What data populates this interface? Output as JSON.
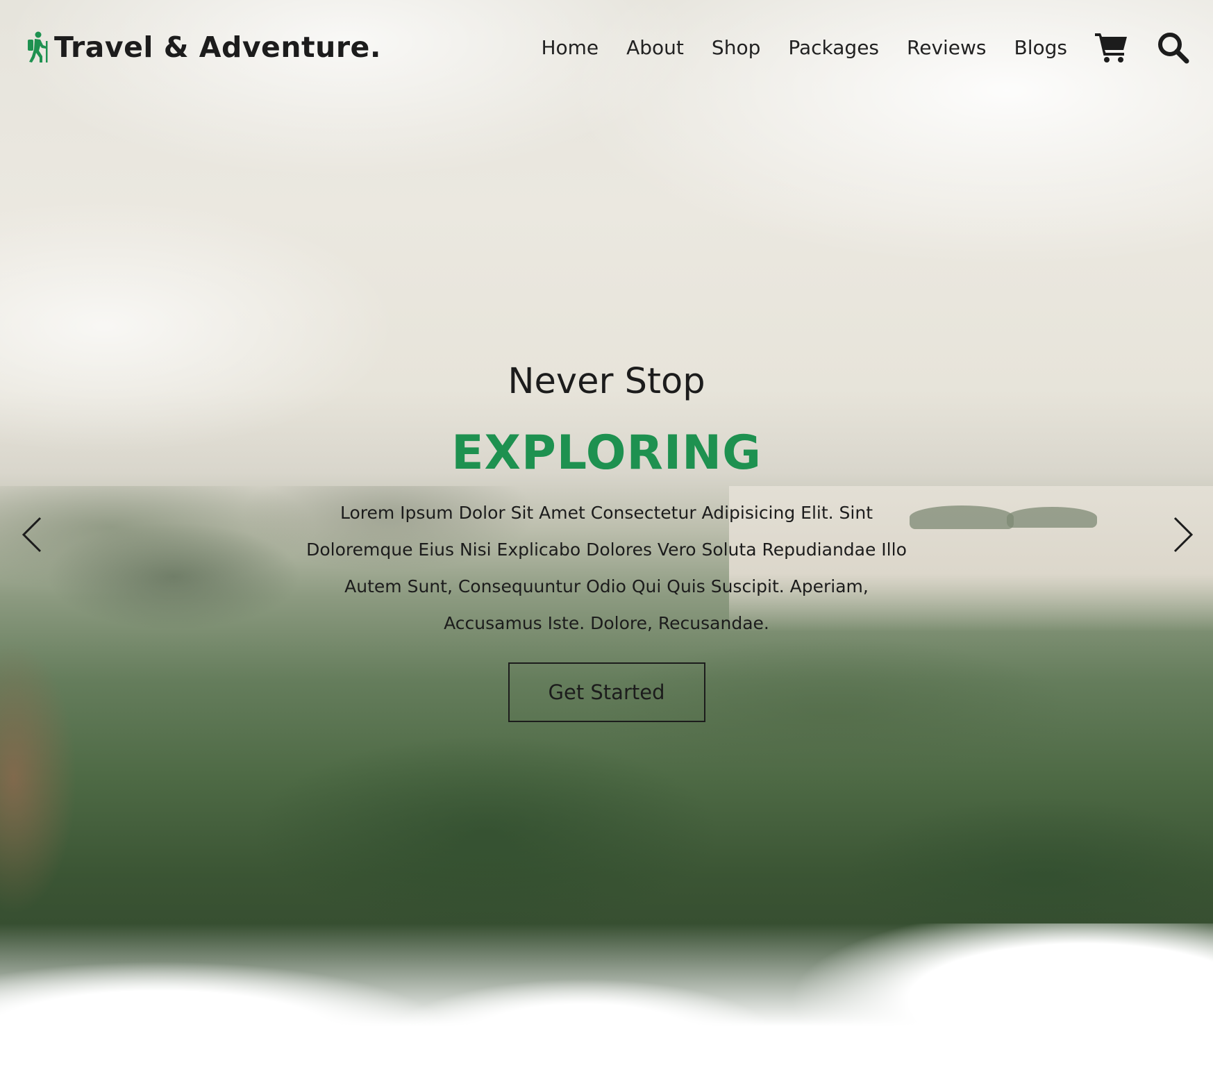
{
  "header": {
    "logo_text": "Travel & Adventure.",
    "logo_icon": "hiker-icon",
    "nav": [
      "Home",
      "About",
      "Shop",
      "Packages",
      "Reviews",
      "Blogs"
    ],
    "icons": [
      "cart-icon",
      "search-icon"
    ]
  },
  "hero": {
    "subtitle": "Never Stop",
    "title": "EXPLORING",
    "description": "Lorem Ipsum Dolor Sit Amet Consectetur Adipisicing Elit. Sint Doloremque Eius Nisi Explicabo Dolores Vero Soluta Repudiandae Illo Autem Sunt, Consequuntur Odio Qui Quis Suscipit. Aperiam, Accusamus Iste. Dolore, Recusandae.",
    "cta_label": "Get Started",
    "prev_icon": "chevron-left-icon",
    "next_icon": "chevron-right-icon"
  },
  "colors": {
    "accent": "#1e9150",
    "text": "#1c1c1c"
  }
}
